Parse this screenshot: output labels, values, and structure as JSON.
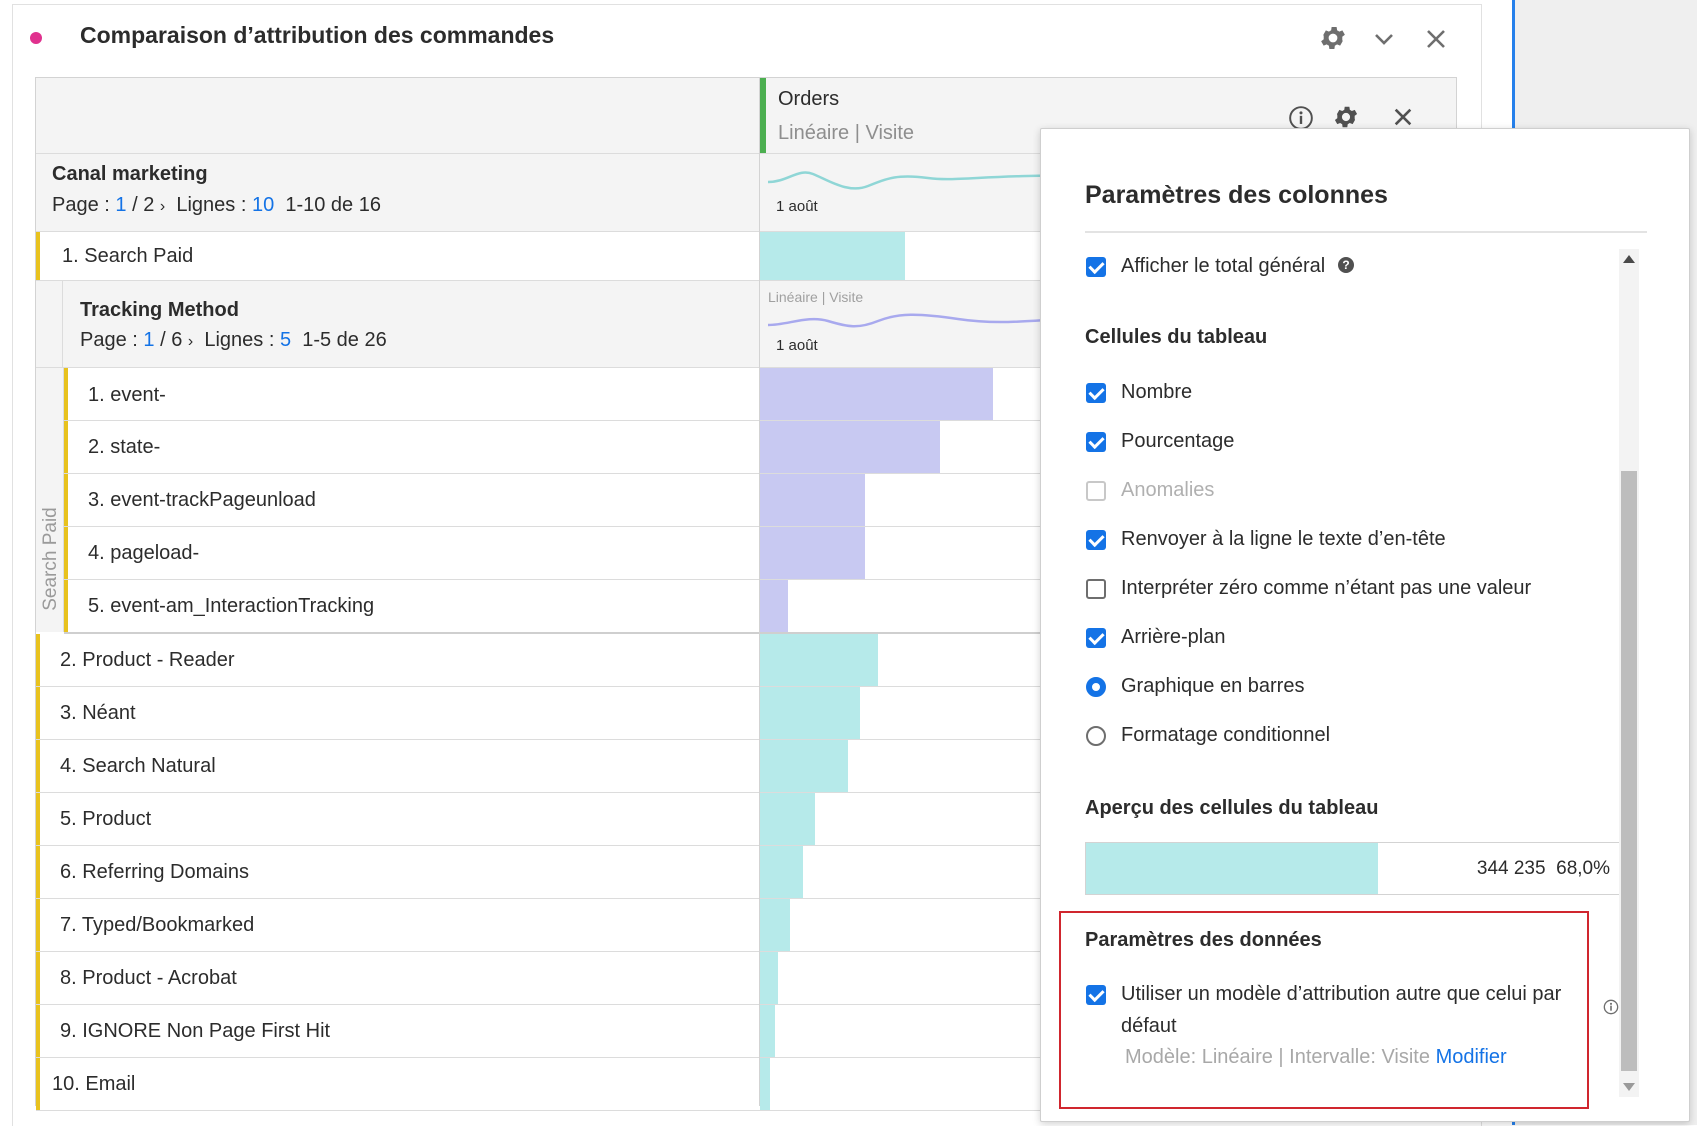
{
  "panel": {
    "title": "Comparaison d’attribution des commandes",
    "dot_color": "#e0318e",
    "icons": [
      "gear-icon",
      "chevron-down-icon",
      "close-icon"
    ]
  },
  "column": {
    "metric": "Orders",
    "attribution": "Linéaire | Visite",
    "icons": [
      "info-icon",
      "gear-icon",
      "close-icon"
    ]
  },
  "marketing": {
    "dimension": "Canal marketing",
    "page_label": "Page :",
    "page_current": "1",
    "page_total": "/ 2",
    "rows_label": "Lignes :",
    "rows_value": "10",
    "rows_range": "1-10 de 16",
    "sparkline_date": "1 août"
  },
  "tracking": {
    "dimension": "Tracking Method",
    "page_label": "Page :",
    "page_current": "1",
    "page_total": "/ 6",
    "rows_label": "Lignes :",
    "rows_value": "5",
    "rows_range": "1-5 de 26",
    "sparkline_header": "Linéaire | Visite",
    "sparkline_date": "1 août",
    "side_label": "Search Paid"
  },
  "rows_top": [
    {
      "label": "1. Search Paid",
      "fill": 0.58
    }
  ],
  "rows_nested": [
    {
      "label": "1. event-",
      "fill": 0.93
    },
    {
      "label": "2. state-",
      "fill": 0.72
    },
    {
      "label": "3. event-trackPageunload",
      "fill": 0.42
    },
    {
      "label": "4. pageload-",
      "fill": 0.42
    },
    {
      "label": "5. event-am_InteractionTracking",
      "fill": 0.11
    }
  ],
  "rows_bottom": [
    {
      "label": "2. Product - Reader",
      "fill": 0.47
    },
    {
      "label": "3. Néant",
      "fill": 0.4
    },
    {
      "label": "4. Search Natural",
      "fill": 0.35
    },
    {
      "label": "5. Product",
      "fill": 0.22
    },
    {
      "label": "6. Referring Domains",
      "fill": 0.17
    },
    {
      "label": "7. Typed/Bookmarked",
      "fill": 0.12
    },
    {
      "label": "8. Product - Acrobat",
      "fill": 0.07
    },
    {
      "label": "9. IGNORE Non Page First Hit",
      "fill": 0.06
    },
    {
      "label": "10. Email",
      "fill": 0.04
    }
  ],
  "settings": {
    "title": "Paramètres des colonnes",
    "show_total": {
      "label": "Afficher le total général",
      "checked": true
    },
    "cells_heading": "Cellules du tableau",
    "options": [
      {
        "label": "Nombre",
        "state": "checked"
      },
      {
        "label": "Pourcentage",
        "state": "checked"
      },
      {
        "label": "Anomalies",
        "state": "disabled"
      },
      {
        "label": "Renvoyer à la ligne le texte d’en-tête",
        "state": "checked"
      },
      {
        "label": "Interpréter zéro comme n’étant pas une valeur",
        "state": "unchecked"
      },
      {
        "label": "Arrière-plan",
        "state": "checked"
      },
      {
        "label": "Graphique en barres",
        "state": "radio-on"
      },
      {
        "label": "Formatage conditionnel",
        "state": "radio-off"
      }
    ],
    "preview_heading": "Aperçu des cellules du tableau",
    "preview_value": "344 235",
    "preview_percent": "68,0%",
    "preview_fill": 0.68,
    "data_heading": "Paramètres des données",
    "data_option_line1": "Utiliser un modèle d’attribution autre que celui par",
    "data_option_line2": "défaut",
    "model_text": "Modèle: Linéaire | Intervalle: Visite",
    "modify_link": "Modifier"
  },
  "colors": {
    "accent": "#1473e6",
    "bar_cyan": "#b6eaea",
    "bar_purple": "#c8c9f2",
    "row_marker": "#e8c21e",
    "highlight_box": "#d0262e",
    "metric_marker": "#4caf50"
  }
}
